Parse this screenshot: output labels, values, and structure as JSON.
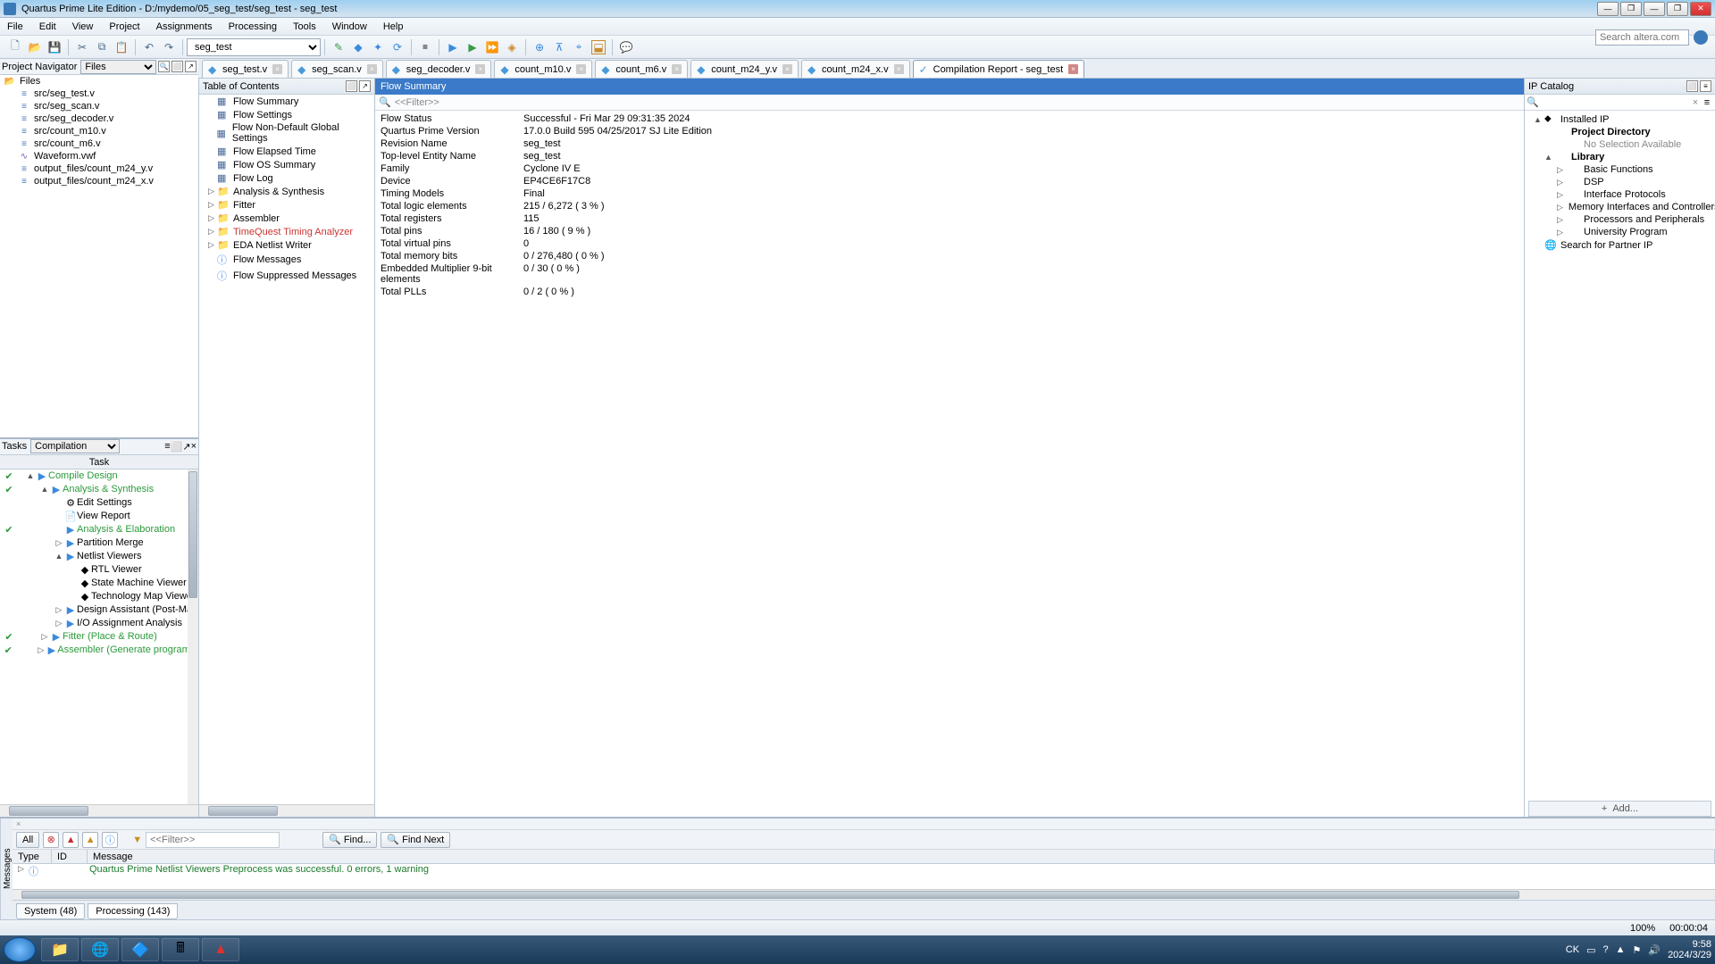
{
  "title": "Quartus Prime Lite Edition - D:/mydemo/05_seg_test/seg_test - seg_test",
  "menu": [
    "File",
    "Edit",
    "View",
    "Project",
    "Assignments",
    "Processing",
    "Tools",
    "Window",
    "Help"
  ],
  "search_placeholder": "Search altera.com",
  "project_select": "seg_test",
  "project_navigator": {
    "title": "Project Navigator",
    "dropdown": "Files",
    "root": "Files",
    "files": [
      "src/seg_test.v",
      "src/seg_scan.v",
      "src/seg_decoder.v",
      "src/count_m10.v",
      "src/count_m6.v",
      "Waveform.vwf",
      "output_files/count_m24_y.v",
      "output_files/count_m24_x.v"
    ]
  },
  "tasks": {
    "title": "Tasks",
    "dropdown": "Compilation",
    "column": "Task",
    "items": [
      {
        "chk": true,
        "exp": "▲",
        "play": true,
        "label": "Compile Design",
        "green": true,
        "ind": 0
      },
      {
        "chk": true,
        "exp": "▲",
        "play": true,
        "label": "Analysis & Synthesis",
        "green": true,
        "ind": 1
      },
      {
        "chk": false,
        "exp": "",
        "play": false,
        "label": "Edit Settings",
        "green": false,
        "ind": 2,
        "ico": "⚙"
      },
      {
        "chk": false,
        "exp": "",
        "play": false,
        "label": "View Report",
        "green": false,
        "ind": 2,
        "ico": "📄"
      },
      {
        "chk": true,
        "exp": "",
        "play": true,
        "label": "Analysis & Elaboration",
        "green": true,
        "ind": 2
      },
      {
        "chk": false,
        "exp": "▷",
        "play": true,
        "label": "Partition Merge",
        "green": false,
        "ind": 2
      },
      {
        "chk": false,
        "exp": "▲",
        "play": true,
        "label": "Netlist Viewers",
        "green": false,
        "ind": 2
      },
      {
        "chk": false,
        "exp": "",
        "play": false,
        "label": "RTL Viewer",
        "green": false,
        "ind": 3,
        "ico": "◆"
      },
      {
        "chk": false,
        "exp": "",
        "play": false,
        "label": "State Machine Viewer",
        "green": false,
        "ind": 3,
        "ico": "◆"
      },
      {
        "chk": false,
        "exp": "",
        "play": false,
        "label": "Technology Map Viewer",
        "green": false,
        "ind": 3,
        "ico": "◆"
      },
      {
        "chk": false,
        "exp": "▷",
        "play": true,
        "label": "Design Assistant (Post-Map",
        "green": false,
        "ind": 2
      },
      {
        "chk": false,
        "exp": "▷",
        "play": true,
        "label": "I/O Assignment Analysis",
        "green": false,
        "ind": 2
      },
      {
        "chk": true,
        "exp": "▷",
        "play": true,
        "label": "Fitter (Place & Route)",
        "green": true,
        "ind": 1
      },
      {
        "chk": true,
        "exp": "▷",
        "play": true,
        "label": "Assembler (Generate programm",
        "green": true,
        "ind": 1
      }
    ]
  },
  "tabs": [
    {
      "label": "seg_test.v",
      "active": false,
      "close": "dim"
    },
    {
      "label": "seg_scan.v",
      "active": false,
      "close": "dim"
    },
    {
      "label": "seg_decoder.v",
      "active": false,
      "close": "dim"
    },
    {
      "label": "count_m10.v",
      "active": false,
      "close": "dim"
    },
    {
      "label": "count_m6.v",
      "active": false,
      "close": "dim"
    },
    {
      "label": "count_m24_y.v",
      "active": false,
      "close": "dim"
    },
    {
      "label": "count_m24_x.v",
      "active": false,
      "close": "dim"
    },
    {
      "label": "Compilation Report - seg_test",
      "active": true,
      "close": "red",
      "ico": "✓"
    }
  ],
  "toc": {
    "title": "Table of Contents",
    "items": [
      {
        "ico": "table",
        "label": "Flow Summary"
      },
      {
        "ico": "table",
        "label": "Flow Settings"
      },
      {
        "ico": "table",
        "label": "Flow Non-Default Global Settings"
      },
      {
        "ico": "table",
        "label": "Flow Elapsed Time"
      },
      {
        "ico": "table",
        "label": "Flow OS Summary"
      },
      {
        "ico": "table",
        "label": "Flow Log"
      },
      {
        "ico": "folder",
        "label": "Analysis & Synthesis",
        "exp": "▷"
      },
      {
        "ico": "folder",
        "label": "Fitter",
        "exp": "▷"
      },
      {
        "ico": "folder",
        "label": "Assembler",
        "exp": "▷"
      },
      {
        "ico": "folder",
        "label": "TimeQuest Timing Analyzer",
        "exp": "▷",
        "red": true
      },
      {
        "ico": "folder",
        "label": "EDA Netlist Writer",
        "exp": "▷"
      },
      {
        "ico": "info",
        "label": "Flow Messages"
      },
      {
        "ico": "info",
        "label": "Flow Suppressed Messages"
      }
    ]
  },
  "flow": {
    "title": "Flow Summary",
    "filter": "<<Filter>>",
    "rows": [
      {
        "k": "Flow Status",
        "v": "Successful - Fri Mar 29 09:31:35 2024"
      },
      {
        "k": "Quartus Prime Version",
        "v": "17.0.0 Build 595 04/25/2017 SJ Lite Edition"
      },
      {
        "k": "Revision Name",
        "v": "seg_test"
      },
      {
        "k": "Top-level Entity Name",
        "v": "seg_test"
      },
      {
        "k": "Family",
        "v": "Cyclone IV E"
      },
      {
        "k": "Device",
        "v": "EP4CE6F17C8"
      },
      {
        "k": "Timing Models",
        "v": "Final"
      },
      {
        "k": "Total logic elements",
        "v": "215 / 6,272 ( 3 % )"
      },
      {
        "k": "Total registers",
        "v": "115"
      },
      {
        "k": "Total pins",
        "v": "16 / 180 ( 9 % )"
      },
      {
        "k": "Total virtual pins",
        "v": "0"
      },
      {
        "k": "Total memory bits",
        "v": "0 / 276,480 ( 0 % )"
      },
      {
        "k": "Embedded Multiplier 9-bit elements",
        "v": "0 / 30 ( 0 % )"
      },
      {
        "k": "Total PLLs",
        "v": "0 / 2 ( 0 % )"
      }
    ]
  },
  "ip": {
    "title": "IP Catalog",
    "items": [
      {
        "exp": "▲",
        "ico": "⬥",
        "label": "Installed IP",
        "lvl": 0
      },
      {
        "exp": "",
        "ico": "",
        "label": "Project Directory",
        "lvl": 1,
        "bold": true
      },
      {
        "exp": "",
        "ico": "",
        "label": "No Selection Available",
        "lvl": 2,
        "gray": true
      },
      {
        "exp": "▲",
        "ico": "",
        "label": "Library",
        "lvl": 1,
        "bold": true
      },
      {
        "exp": "▷",
        "ico": "",
        "label": "Basic Functions",
        "lvl": 2
      },
      {
        "exp": "▷",
        "ico": "",
        "label": "DSP",
        "lvl": 2
      },
      {
        "exp": "▷",
        "ico": "",
        "label": "Interface Protocols",
        "lvl": 2
      },
      {
        "exp": "▷",
        "ico": "",
        "label": "Memory Interfaces and Controllers",
        "lvl": 2
      },
      {
        "exp": "▷",
        "ico": "",
        "label": "Processors and Peripherals",
        "lvl": 2
      },
      {
        "exp": "▷",
        "ico": "",
        "label": "University Program",
        "lvl": 2
      },
      {
        "exp": "",
        "ico": "🌐",
        "label": "Search for Partner IP",
        "lvl": 0
      }
    ],
    "add": "Add..."
  },
  "messages": {
    "vert": "Messages",
    "all": "All",
    "filter": "<<Filter>>",
    "find": "Find...",
    "find_next": "Find Next",
    "columns": [
      "Type",
      "ID",
      "Message"
    ],
    "row": {
      "type": "ⓘ",
      "id": "",
      "msg": "Quartus Prime Netlist Viewers Preprocess was successful. 0 errors, 1 warning"
    },
    "tabs": [
      "System (48)",
      "Processing (143)"
    ]
  },
  "status": {
    "zoom": "100%",
    "time": "00:00:04"
  },
  "tray": {
    "lang": "CK",
    "time": "9:58",
    "date": "2024/3/29"
  }
}
